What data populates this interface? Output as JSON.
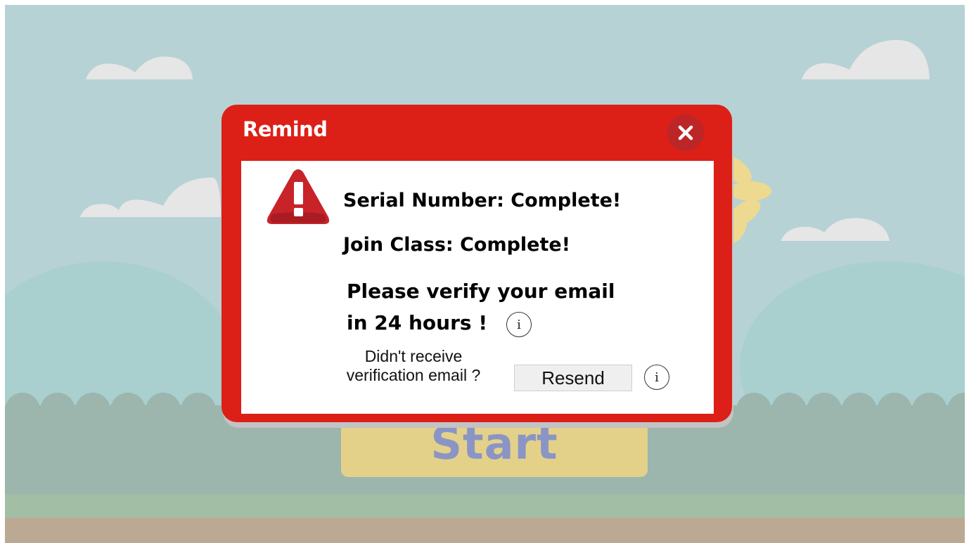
{
  "background": {
    "start_button_label": "Start"
  },
  "dialog": {
    "title": "Remind",
    "close_icon": "close-icon",
    "warning_icon": "warning-triangle-icon",
    "lines": [
      "Serial Number: Complete!",
      "Join Class: Complete!",
      "Please verify your email",
      "in 24 hours !"
    ],
    "resend_note_line1": "Didn't receive",
    "resend_note_line2": "verification email ?",
    "resend_button": "Resend",
    "info_icon": "info-icon"
  },
  "colors": {
    "dialog_red": "#dc1f17",
    "close_button": "#bd2627",
    "sky": "#b7d2d4",
    "start_button": "#e3d189",
    "start_text": "#8a95c6"
  }
}
